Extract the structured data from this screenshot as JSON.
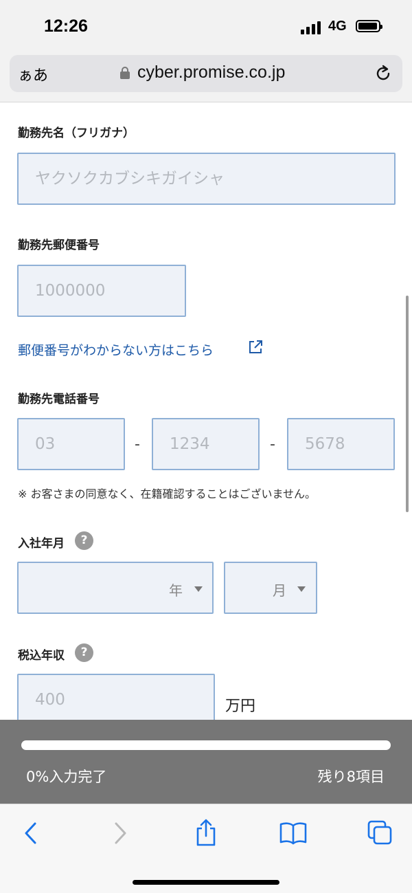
{
  "status_bar": {
    "time": "12:26",
    "network": "4G"
  },
  "browser": {
    "text_size_label": "ぁあ",
    "url": "cyber.promise.co.jp"
  },
  "form": {
    "employer_kana": {
      "label": "勤務先名（フリガナ）",
      "placeholder": "ヤクソクカブシキガイシャ"
    },
    "employer_postal": {
      "label": "勤務先郵便番号",
      "placeholder": "1000000"
    },
    "postal_link": "郵便番号がわからない方はこちら",
    "employer_phone": {
      "label": "勤務先電話番号",
      "part1_placeholder": "03",
      "part2_placeholder": "1234",
      "part3_placeholder": "5678",
      "separator": "-",
      "note": "※ お客さまの同意なく、在籍確認することはございません。"
    },
    "join_date": {
      "label": "入社年月",
      "year_label": "年",
      "month_label": "月",
      "help": "?"
    },
    "annual_income": {
      "label": "税込年収",
      "placeholder": "400",
      "unit": "万円",
      "help": "?"
    }
  },
  "progress": {
    "percent_value": 0,
    "percent_text": "0%入力完了",
    "remaining_text": "残り8項目"
  },
  "colors": {
    "field_bg": "#eef2f8",
    "field_border": "#8fb0d6",
    "link": "#1e5aa8",
    "toolbar_icon": "#1a73e8",
    "progress_bg": "#767676"
  }
}
